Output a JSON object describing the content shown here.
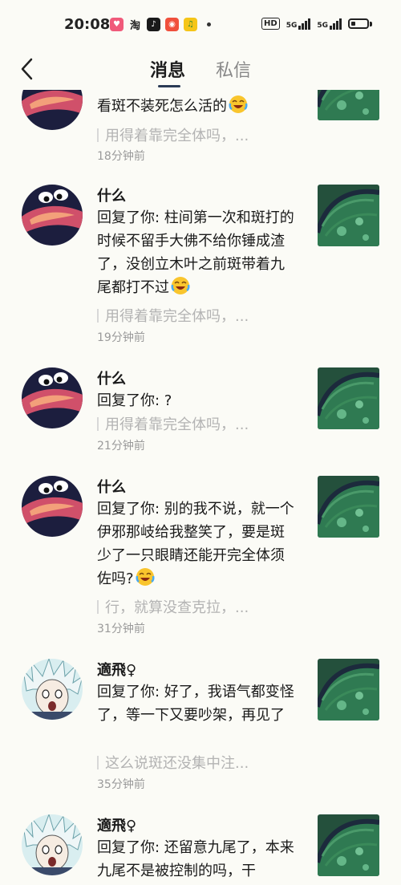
{
  "status_bar": {
    "time": "20:08",
    "app_icons": [
      "heart-app-icon",
      "taobao-icon",
      "tiktok-icon",
      "shopping-app-icon",
      "music-app-icon"
    ],
    "app_icon_labels": {
      "taobao": "淘"
    },
    "hd": "HD",
    "signal1": "5G",
    "signal2": "5G"
  },
  "header": {
    "tab_active": "消息",
    "tab_inactive": "私信"
  },
  "items": [
    {
      "name": "",
      "body": "看斑不装死怎么活的",
      "emoji": "laugh-cry-emoji",
      "quote": "用得着靠完全体吗，...",
      "time": "18分钟前"
    },
    {
      "name": "什么",
      "body": "回复了你: 柱间第一次和斑打的时候不留手大佛不给你锤成渣了，没创立木叶之前斑带着九尾都打不过",
      "emoji": "laugh-cry-emoji",
      "quote": "用得着靠完全体吗，...",
      "time": "19分钟前"
    },
    {
      "name": "什么",
      "body": "回复了你: ?",
      "quote": "用得着靠完全体吗，...",
      "time": "21分钟前"
    },
    {
      "name": "什么",
      "body": "回复了你: 别的我不说，就一个伊邪那岐给我整笑了，要是斑少了一只眼睛还能开完全体须佐吗?",
      "emoji": "laugh-cry-emoji",
      "quote": "行，就算没查克拉，...",
      "time": "31分钟前"
    },
    {
      "name": "適飛♀",
      "body": "回复了你: 好了，我语气都变怪了，等一下又要吵架，再见了",
      "quote": "这么说斑还没集中注...",
      "time": "35分钟前"
    },
    {
      "name": "適飛♀",
      "body": "回复了你: 还留意九尾了，本来九尾不是被控制的吗，干",
      "quote": "",
      "time": ""
    }
  ],
  "colors": {
    "background": "#fbfbf6",
    "avatar_dark": "#1c1e3e",
    "avatar_pink": "#d0506a",
    "thumb_green": "#2f7a52"
  }
}
